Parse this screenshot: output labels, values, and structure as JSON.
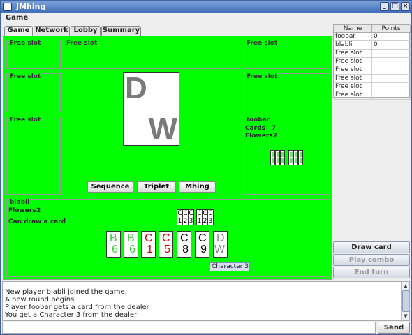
{
  "window": {
    "title": "JMhing"
  },
  "menu": {
    "game": "Game"
  },
  "tabs": [
    {
      "label": "Game",
      "active": true
    },
    {
      "label": "Network",
      "active": false
    },
    {
      "label": "Lobby",
      "active": false
    },
    {
      "label": "Summary",
      "active": false
    }
  ],
  "board": {
    "slots": {
      "top_left": "Free slot",
      "top_center": "Free slot",
      "top_right": "Free slot",
      "mid_left": "Free slot",
      "mid_right": "Free slot",
      "lower_left": "Free slot"
    },
    "center_tile": {
      "top": "D",
      "bottom": "W"
    },
    "foobar": {
      "name": "foobar",
      "cards_label": "Cards",
      "cards_value": "7",
      "flowers_label": "Flowers",
      "flowers_value": "2"
    },
    "buttons": {
      "sequence": "Sequence",
      "triplet": "Triplet",
      "mhing": "Mhing"
    },
    "player": {
      "name": "blabli",
      "flowers_label": "Flowers",
      "flowers_value": "2",
      "status": "Can draw a card",
      "sets": [
        [
          {
            "t": "C",
            "b": "1"
          },
          {
            "t": "C",
            "b": "2"
          },
          {
            "t": "C",
            "b": "3"
          }
        ],
        [
          {
            "t": "C",
            "b": "1"
          },
          {
            "t": "C",
            "b": "2"
          },
          {
            "t": "C",
            "b": "3"
          }
        ]
      ],
      "hand": [
        {
          "t": "B",
          "b": "6",
          "color": "#33cc33"
        },
        {
          "t": "B",
          "b": "6",
          "color": "#33cc33"
        },
        {
          "t": "C",
          "b": "1",
          "color": "#e00000"
        },
        {
          "t": "C",
          "b": "5",
          "color": "#e00000"
        },
        {
          "t": "C",
          "b": "8",
          "color": "#000000"
        },
        {
          "t": "C",
          "b": "9",
          "color": "#000000"
        },
        {
          "t": "D",
          "b": "W",
          "color": "#888888"
        }
      ]
    },
    "tooltip": "Character 3"
  },
  "scores": {
    "headers": [
      "Name",
      "Points"
    ],
    "rows": [
      [
        "foobar",
        "0"
      ],
      [
        "blabli",
        "0"
      ],
      [
        "Free slot",
        ""
      ],
      [
        "Free slot",
        ""
      ],
      [
        "Free slot",
        ""
      ],
      [
        "Free slot",
        ""
      ],
      [
        "Free slot",
        ""
      ],
      [
        "Free slot",
        ""
      ]
    ]
  },
  "actions": {
    "draw_card": {
      "label": "Draw card",
      "enabled": true
    },
    "play_combo": {
      "label": "Play combo",
      "enabled": false
    },
    "end_turn": {
      "label": "End turn",
      "enabled": false
    }
  },
  "log": [
    "New player blabli joined the game.",
    "A new round begins.",
    "Player foobar gets a card from the dealer",
    "You get a Character 3 from the dealer"
  ],
  "chat": {
    "value": "",
    "send_label": "Send"
  }
}
